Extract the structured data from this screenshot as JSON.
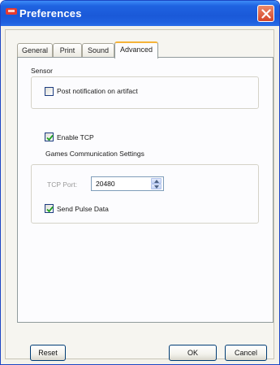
{
  "window": {
    "title": "Preferences"
  },
  "tabs": [
    {
      "label": "General"
    },
    {
      "label": "Print"
    },
    {
      "label": "Sound"
    },
    {
      "label": "Advanced"
    }
  ],
  "active_tab": "Advanced",
  "sensor": {
    "heading": "Sensor",
    "post_notification": {
      "label": "Post notification on artifact",
      "checked": false
    }
  },
  "tcp": {
    "enable": {
      "label": "Enable TCP",
      "checked": true
    },
    "heading": "Games Communication Settings",
    "port_label": "TCP Port:",
    "port_value": "20480",
    "send_pulse": {
      "label": "Send Pulse Data",
      "checked": true
    }
  },
  "buttons": {
    "reset": "Reset",
    "ok": "OK",
    "cancel": "Cancel"
  },
  "colors": {
    "titlebar": "#1f63e1",
    "active_tab_highlight": "#f5b33a",
    "check_mark": "#21a121",
    "close_button": "#d4452a"
  }
}
